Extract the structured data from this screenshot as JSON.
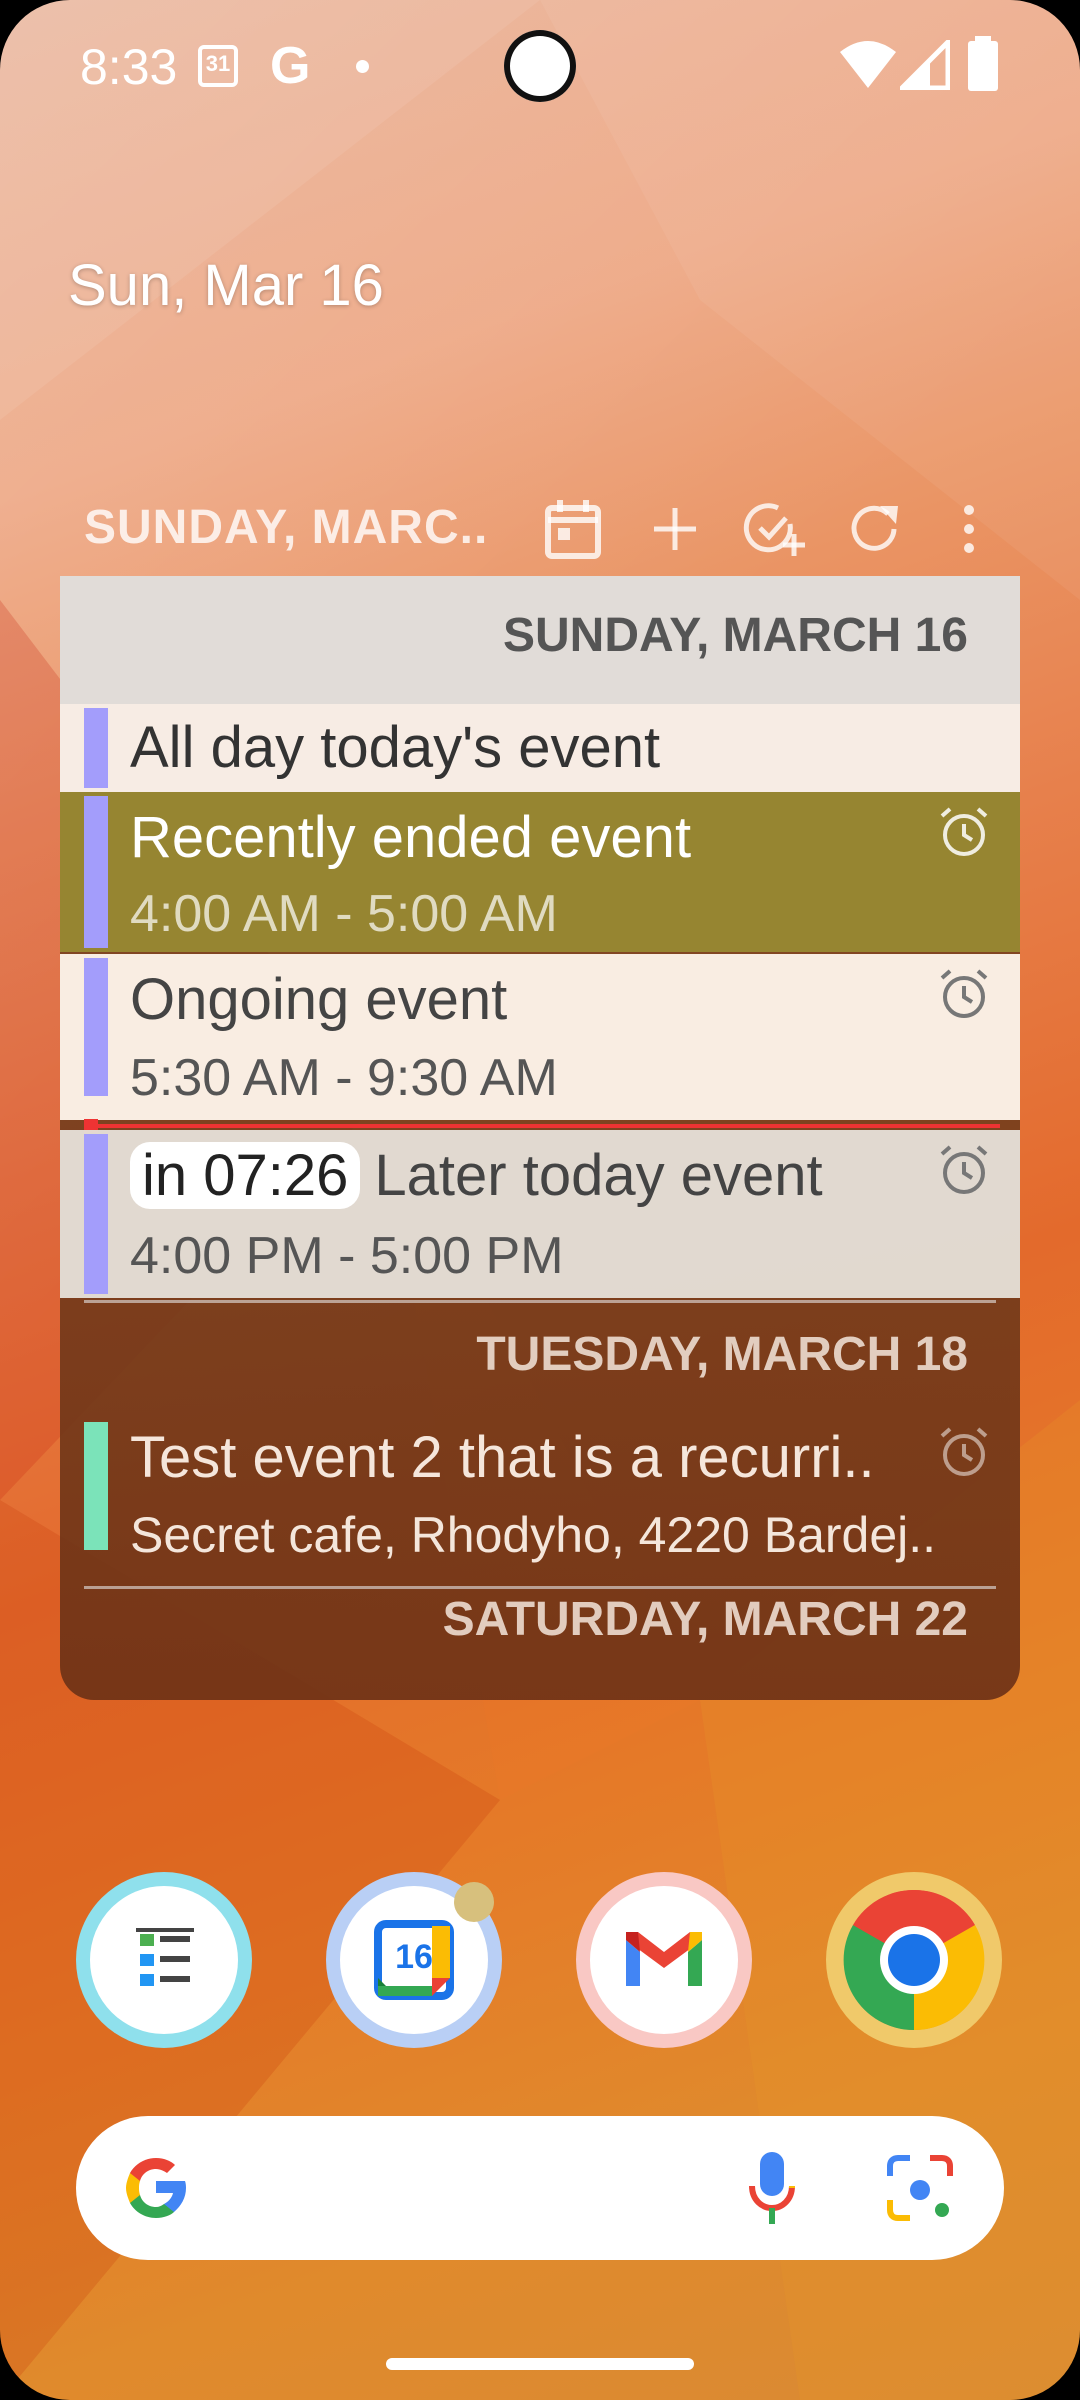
{
  "status_bar": {
    "time": "8:33",
    "calendar_icon_day": "31",
    "g_label": "G",
    "icons": [
      "calendar-notification-icon",
      "google-icon",
      "dot-icon",
      "wifi-icon",
      "signal-icon",
      "battery-icon"
    ]
  },
  "home": {
    "date": "Sun, Mar 16"
  },
  "widget": {
    "header_title": "SUNDAY, MARC..",
    "header_icons": [
      "calendar-icon",
      "add-icon",
      "add-task-icon",
      "refresh-icon",
      "more-vert-icon"
    ],
    "days": [
      {
        "header": "SUNDAY, MARCH 16",
        "events": [
          {
            "title": "All day today's event",
            "time": ""
          },
          {
            "title": "Recently ended event",
            "time": "4:00 AM - 5:00 AM",
            "alarm": true
          },
          {
            "title": "Ongoing event",
            "time": "5:30 AM - 9:30 AM",
            "alarm": true
          },
          {
            "countdown": "in 07:26",
            "title": "Later today event",
            "time": "4:00 PM - 5:00 PM",
            "alarm": true
          }
        ]
      },
      {
        "header": "TUESDAY, MARCH 18",
        "events": [
          {
            "title": "Test event 2 that is a recurri..",
            "time": "Secret cafe, Rhodyho, 4220 Bardej..",
            "alarm": true
          }
        ]
      },
      {
        "header": "SATURDAY, MARCH 22",
        "events": []
      }
    ],
    "colors": {
      "event_bar_purple": "#a39dfb",
      "event_bar_green": "#7be3b9",
      "now_line": "#e33333"
    }
  },
  "dock": {
    "apps": [
      {
        "name": "tasks-app-icon"
      },
      {
        "name": "calendar-app-icon",
        "label": "16"
      },
      {
        "name": "gmail-app-icon"
      },
      {
        "name": "chrome-app-icon"
      }
    ]
  },
  "search": {
    "icons": [
      "google-g-icon",
      "microphone-icon",
      "lens-icon"
    ]
  }
}
